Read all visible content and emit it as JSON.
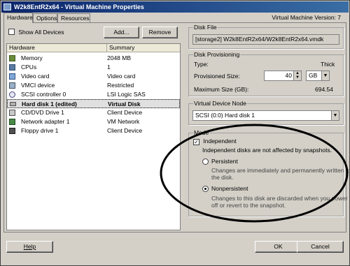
{
  "window": {
    "title": "W2k8EntR2x64 - Virtual Machine Properties"
  },
  "tabs": [
    "Hardware",
    "Options",
    "Resources"
  ],
  "vm_version": "Virtual Machine Version: 7",
  "left": {
    "show_all_label": "Show All Devices",
    "add_label": "Add...",
    "remove_label": "Remove",
    "columns": [
      "Hardware",
      "Summary"
    ],
    "rows": [
      {
        "icon": "memory-icon",
        "name": "Memory",
        "summary": "2048 MB"
      },
      {
        "icon": "cpu-icon",
        "name": "CPUs",
        "summary": "1"
      },
      {
        "icon": "video-card-icon",
        "name": "Video card",
        "summary": "Video card"
      },
      {
        "icon": "vmci-icon",
        "name": "VMCI device",
        "summary": "Restricted"
      },
      {
        "icon": "scsi-controller-icon",
        "name": "SCSI controller 0",
        "summary": "LSI Logic SAS"
      },
      {
        "icon": "hard-disk-icon",
        "name": "Hard disk 1 (edited)",
        "summary": "Virtual Disk"
      },
      {
        "icon": "cd-dvd-icon",
        "name": "CD/DVD Drive 1",
        "summary": "Client Device"
      },
      {
        "icon": "network-adapter-icon",
        "name": "Network adapter 1",
        "summary": "VM Network"
      },
      {
        "icon": "floppy-icon",
        "name": "Floppy drive 1",
        "summary": "Client Device"
      }
    ]
  },
  "disk_file": {
    "label": "Disk File",
    "value": "[storage2] W2k8EntR2x64/W2k8EntR2x64.vmdk"
  },
  "provisioning": {
    "label": "Disk Provisioning",
    "type_label": "Type:",
    "type_value": "Thick",
    "size_label": "Provisioned Size:",
    "size_value": "40",
    "size_unit": "GB",
    "max_label": "Maximum Size (GB):",
    "max_value": "694.54"
  },
  "device_node": {
    "label": "Virtual Device Node",
    "value": "SCSI (0:0) Hard disk 1"
  },
  "mode": {
    "label": "Mode",
    "independent_label": "Independent",
    "independent_desc": "Independent disks are not affected by snapshots.",
    "persistent_label": "Persistent",
    "persistent_desc_1": "Changes are immediately and permanently written to",
    "persistent_desc_2": "the disk.",
    "nonpersistent_label": "Nonpersistent",
    "nonpersistent_desc_1": "Changes to this disk are discarded when you power",
    "nonpersistent_desc_2": "off or revert to the snapshot."
  },
  "footer": {
    "help_label": "Help",
    "ok_label": "OK",
    "cancel_label": "Cancel"
  }
}
